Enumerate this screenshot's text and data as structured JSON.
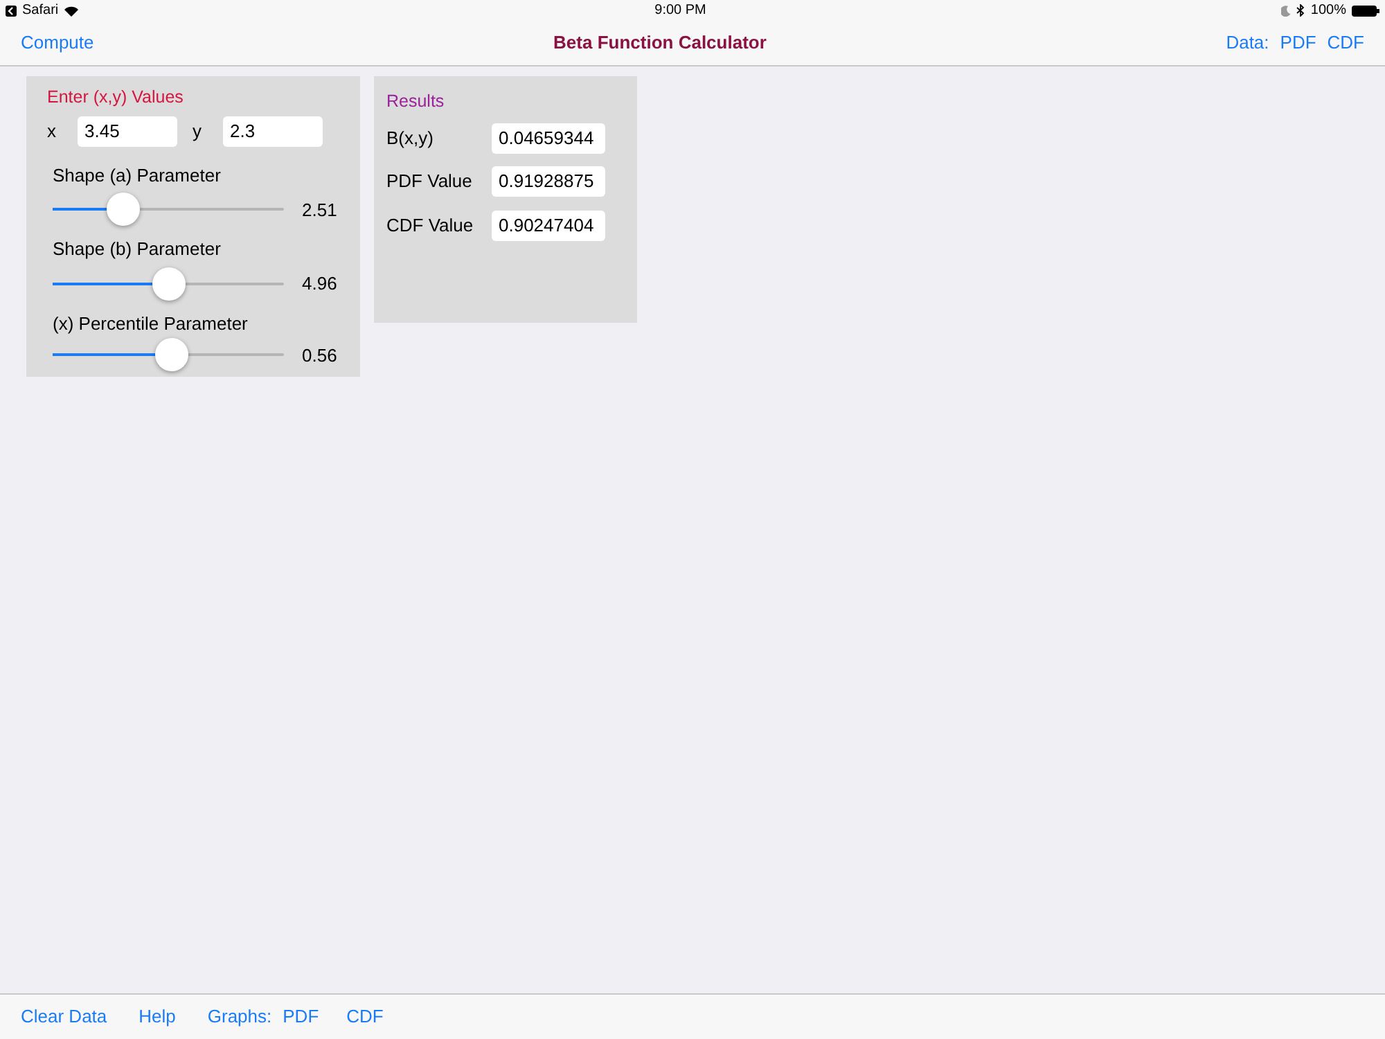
{
  "status_bar": {
    "back_app": "Safari",
    "time": "9:00 PM",
    "battery": "100%"
  },
  "nav_bar": {
    "left_button": "Compute",
    "title": "Beta Function Calculator",
    "right_label": "Data:",
    "right_links": [
      "PDF",
      "CDF"
    ]
  },
  "input_panel": {
    "title": "Enter (x,y) Values",
    "fields": [
      {
        "label": "x",
        "value": "3.45"
      },
      {
        "label": "y",
        "value": "2.3"
      }
    ],
    "sliders": [
      {
        "label": "Shape (a) Parameter",
        "level": 0.275,
        "reading": "2.51"
      },
      {
        "label": "Shape (b) Parameter",
        "level": 0.5,
        "reading": "4.96"
      },
      {
        "label": "(x) Percentile Parameter",
        "level": 0.515,
        "reading": "0.56"
      }
    ]
  },
  "results_panel": {
    "title": "Results",
    "rows": [
      {
        "label": "B(x,y)",
        "value": "0.04659344"
      },
      {
        "label": "PDF Value",
        "value": "0.91928875"
      },
      {
        "label": "CDF Value",
        "value": "0.90247404"
      }
    ]
  },
  "toolbar": {
    "links": [
      "Clear Data",
      "Help"
    ],
    "graphs_label": "Graphs:",
    "graphs_links": [
      "PDF",
      "CDF"
    ]
  }
}
